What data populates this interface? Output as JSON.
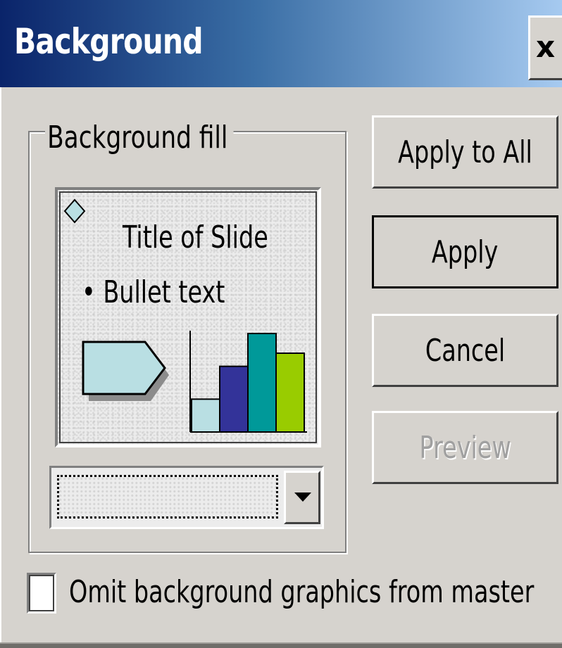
{
  "dialog": {
    "title": "Background",
    "close_glyph": "x"
  },
  "background_fill": {
    "legend": "Background fill",
    "preview": {
      "title": "Title of Slide",
      "bullet": "•  Bullet text",
      "bar_values": [
        1,
        2,
        3,
        2.4
      ],
      "bar_colors": [
        "#b9dfe3",
        "#333399",
        "#009999",
        "#99cc00"
      ],
      "arrow_color": "#b9dfe3",
      "diamond_color": "#b9dfe3"
    },
    "fill_select": {
      "value": ""
    }
  },
  "buttons": {
    "apply_to_all": "Apply to All",
    "apply": "Apply",
    "cancel": "Cancel",
    "preview": "Preview"
  },
  "omit_graphics": {
    "label": "Omit background graphics from master",
    "checked": false
  }
}
